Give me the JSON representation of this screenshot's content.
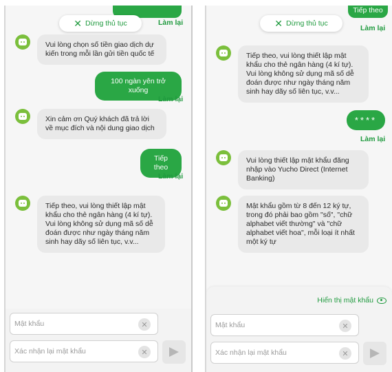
{
  "stop_label": "Dừng thủ tục",
  "redo_label": "Làm lại",
  "left": {
    "bot1": "Vui lòng chọn số tiền giao dịch dự kiến trong mỗi lần gửi tiền quốc tế",
    "user1": "100 ngàn yên trở xuống",
    "bot2": "Xin cảm ơn Quý khách đã trả lời về mục đích và nội dung giao dịch",
    "user2": "Tiếp theo",
    "bot3": "Tiếp theo, vui lòng thiết lập mật khẩu cho thẻ ngân hàng (4 kí tự). Vui lòng không sử dụng mã số dễ đoán được như ngày tháng năm sinh hay dãy số liên tục, v.v..."
  },
  "right": {
    "top_user": "Tiếp theo",
    "bot1": "Tiếp theo, vui lòng thiết lập mật khẩu cho thẻ ngân hàng (4 kí tự). Vui lòng không sử dụng mã số dễ đoán được như ngày tháng năm sinh hay dãy số liên tục, v.v...",
    "user1": "****",
    "bot2": "Vui lòng thiết lập mật khẩu đăng nhập vào Yucho Direct (Internet Banking)",
    "bot3": "Mật khẩu gồm từ 8 đến 12 ký tự, trong đó phải bao gồm \"số\", \"chữ alphabet viết thường\" và \"chữ alphabet viết hoa\", mỗi loại ít nhất một ký tự",
    "show_password": "Hiển thị mật khẩu"
  },
  "form": {
    "password_placeholder": "Mật khẩu",
    "confirm_placeholder": "Xác nhận lại mật khẩu"
  },
  "colors": {
    "accent": "#2aa745",
    "avatar": "#7bbf3c",
    "bot_bubble": "#e9e9e9"
  },
  "icons": {
    "stop": "close-icon",
    "clear": "clear-icon",
    "send": "send-icon",
    "eye": "eye-icon",
    "avatar": "bot-avatar-icon"
  }
}
